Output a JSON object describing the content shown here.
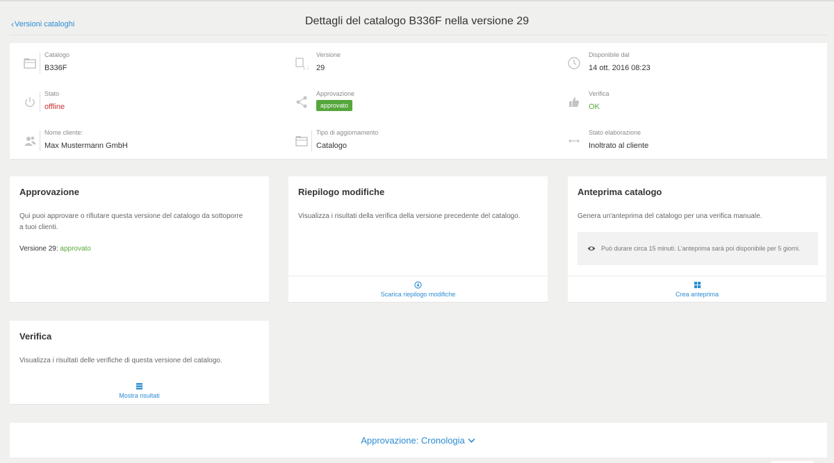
{
  "header": {
    "back_label": "Versioni cataloghi",
    "title": "Dettagli del catalogo B336F nella versione 29"
  },
  "summary": {
    "catalog": {
      "label": "Catalogo",
      "value": "B336F"
    },
    "version": {
      "label": "Versione",
      "value": "29"
    },
    "available": {
      "label": "Disponibile dal",
      "value": "14 ott. 2016 08:23"
    },
    "state": {
      "label": "Stato",
      "value": "offline"
    },
    "approval": {
      "label": "Approvazione",
      "value": "approvato"
    },
    "check": {
      "label": "Verifica",
      "value": "OK"
    },
    "customer": {
      "label": "Nome cliente:",
      "value": "Max Mustermann GmbH"
    },
    "update_type": {
      "label": "Tipo di aggiornamento",
      "value": "Catalogo"
    },
    "processing": {
      "label": "Stato elaborazione",
      "value": "Inoltrato al cliente"
    }
  },
  "cards": {
    "approval": {
      "title": "Approvazione",
      "desc": "Qui puoi approvare o rifiutare questa versione del catalogo da sottoporre a tuoi clienti.",
      "status_prefix": "Versione 29:",
      "status_value": "approvato"
    },
    "changes": {
      "title": "Riepilogo modifiche",
      "desc": "Visualizza i risultati della verifica della versione precedente del catalogo.",
      "action": "Scarica riepilogo modifiche"
    },
    "preview": {
      "title": "Anteprima catalogo",
      "desc": "Genera un'anteprima del catalogo per una verifica manuale.",
      "info": "Può durare circa 15 minuti. L'anteprima sarà poi disponibile per 5 giorni.",
      "action": "Crea anteprima"
    },
    "verification": {
      "title": "Verifica",
      "desc": "Visualizza i risultati delle verifiche di questa versione del catalogo.",
      "action": "Mostra risultati"
    }
  },
  "history": {
    "label": "Approvazione: Cronologia"
  },
  "colors": {
    "accent": "#2a8cd1",
    "success": "#55a63b",
    "danger": "#cc3030",
    "background": "#f0f0ef"
  }
}
